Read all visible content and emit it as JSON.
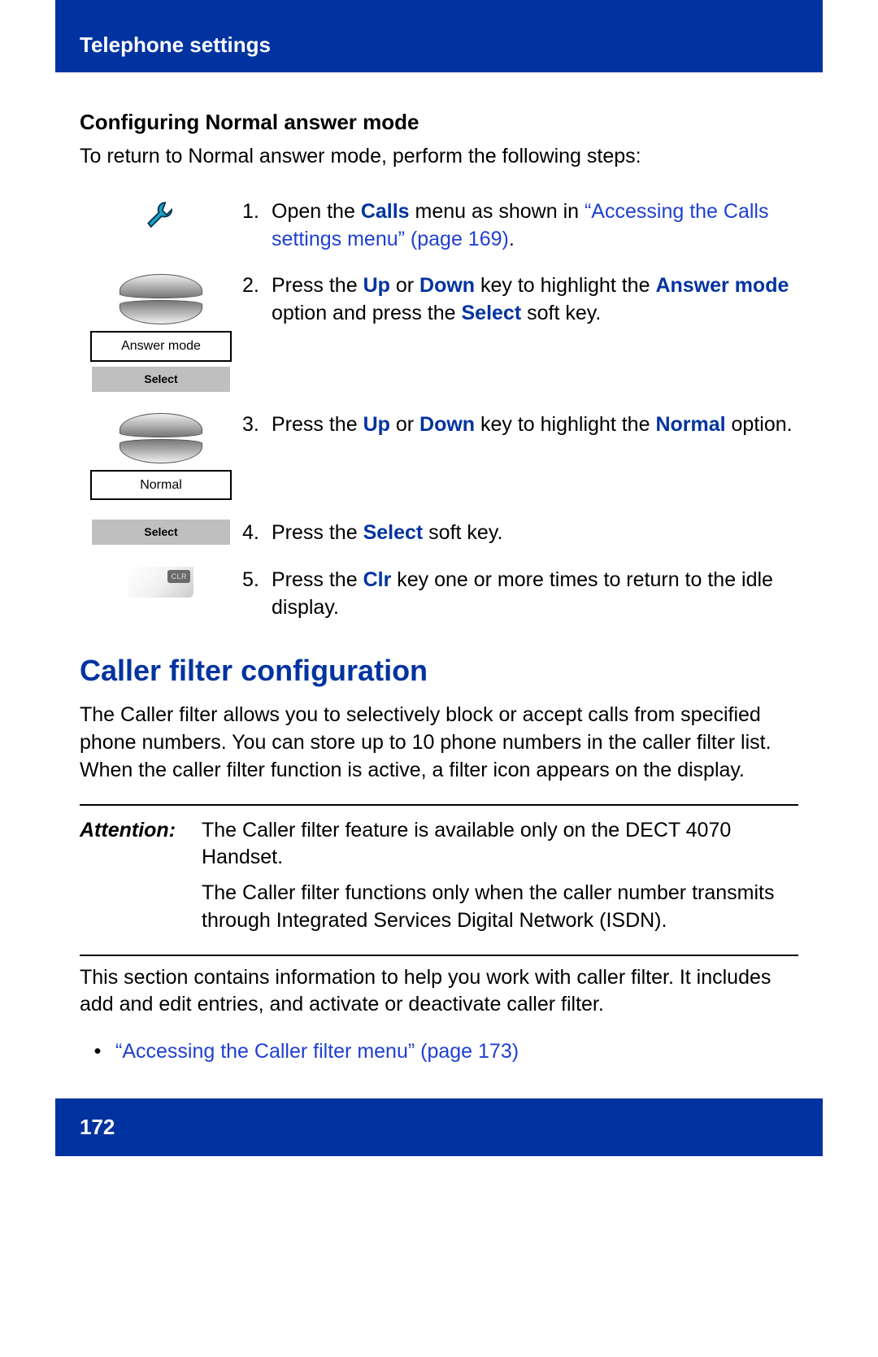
{
  "header": {
    "title": "Telephone settings"
  },
  "section1": {
    "heading": "Configuring Normal answer mode",
    "intro": "To return to Normal answer mode, perform the following steps:"
  },
  "steps": {
    "s1": {
      "num": "1.",
      "t1": "Open the ",
      "calls": "Calls",
      "t2": " menu as shown in ",
      "link": "“Accessing the Calls settings menu” (page 169)",
      "t3": "."
    },
    "s2": {
      "num": "2.",
      "t1": "Press the ",
      "up": "Up",
      "t2": " or ",
      "down": "Down",
      "t3": " key to highlight the ",
      "ans": "Answer mode",
      "t4": " option and press the ",
      "sel": "Select",
      "t5": " soft key.",
      "lcd": "Answer mode",
      "softkey": "Select"
    },
    "s3": {
      "num": "3.",
      "t1": "Press the ",
      "up": "Up",
      "t2": " or ",
      "down": "Down",
      "t3": " key to highlight the ",
      "normal": "Normal",
      "t4": " option.",
      "lcd": "Normal"
    },
    "s4": {
      "num": "4.",
      "t1": "Press the ",
      "sel": "Select",
      "t2": " soft key.",
      "softkey": "Select"
    },
    "s5": {
      "num": "5.",
      "t1": "Press the ",
      "clr": "Clr",
      "t2": " key one or more times to return to the idle display."
    }
  },
  "section2": {
    "title": "Caller filter configuration",
    "para": "The Caller filter allows you to selectively block or accept calls from specified phone numbers. You can store up to 10 phone numbers in the caller filter list. When the caller filter function is active, a filter icon appears on the display."
  },
  "attention": {
    "label": "Attention:",
    "p1": "The Caller filter feature is available only on the DECT 4070 Handset.",
    "p2": "The Caller filter functions only when the caller number transmits through Integrated Services Digital Network (ISDN)."
  },
  "closing": {
    "para": "This section contains information to help you work with caller filter. It includes add and edit entries, and activate or deactivate caller filter.",
    "bullet": "“Accessing the Caller filter menu” (page 173)"
  },
  "footer": {
    "page": "172"
  }
}
